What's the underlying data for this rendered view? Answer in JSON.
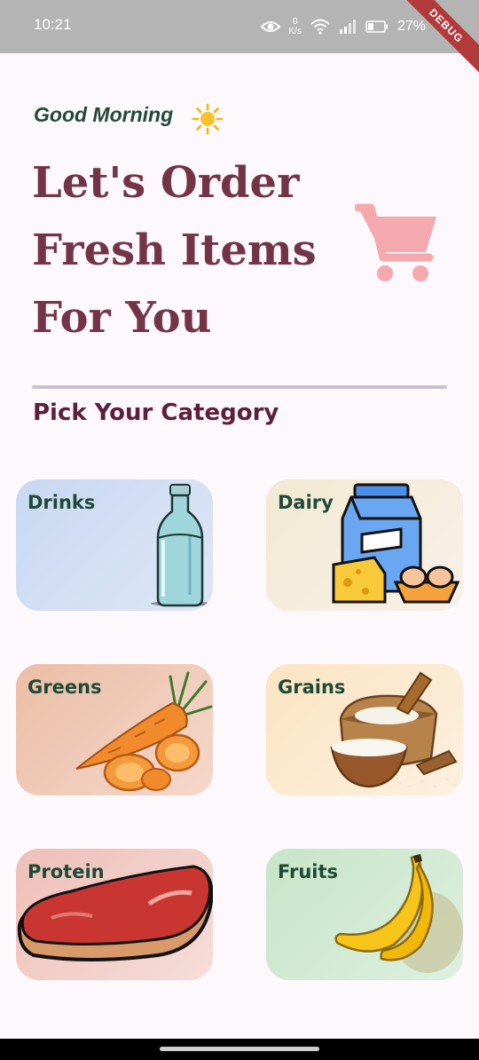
{
  "status_bar": {
    "time": "10:21",
    "net_speed_value": "0",
    "net_speed_unit": "K/s",
    "battery": "27%",
    "icons": [
      "eye-icon",
      "wifi-icon",
      "signal-icon",
      "battery-icon"
    ]
  },
  "debug_banner": "DEBUG",
  "header": {
    "greeting": "Good Morning",
    "greeting_icon": "sun-icon",
    "title_lines": [
      "Let's Order",
      "Fresh Items",
      "For You"
    ],
    "cart_icon": "shopping-cart-icon"
  },
  "section": {
    "title": "Pick Your Category"
  },
  "categories": [
    {
      "label": "Drinks",
      "image": "water-bottle",
      "bg_from": "#c9d8f2",
      "bg_to": "#dde6f6"
    },
    {
      "label": "Dairy",
      "image": "milk-carton-cheese-eggs",
      "bg_from": "#f2e9d2",
      "bg_to": "#f8f1e8"
    },
    {
      "label": "Greens",
      "image": "carrots",
      "bg_from": "#ebbea6",
      "bg_to": "#f4d8cb"
    },
    {
      "label": "Grains",
      "image": "rice-sack",
      "bg_from": "#fbe4c2",
      "bg_to": "#fdf0e0"
    },
    {
      "label": "Protein",
      "image": "steak",
      "bg_from": "#eebfb8",
      "bg_to": "#f6ddd8"
    },
    {
      "label": "Fruits",
      "image": "bananas",
      "bg_from": "#c7e5c8",
      "bg_to": "#deefdf"
    }
  ],
  "colors": {
    "accent": "#733448",
    "section_title": "#5e1f3a",
    "label_green": "#1e4a37",
    "cart_pink": "#f4a9ae"
  }
}
